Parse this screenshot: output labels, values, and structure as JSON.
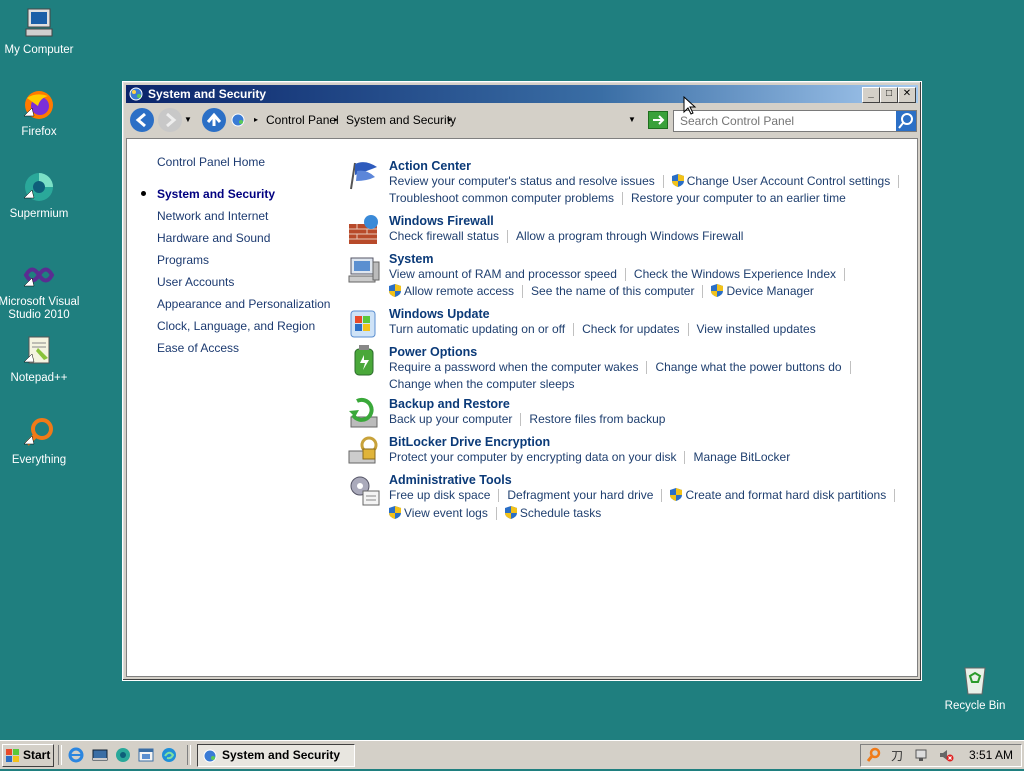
{
  "desktop": {
    "icons": [
      {
        "label": "My Computer"
      },
      {
        "label": "Firefox"
      },
      {
        "label": "Supermium"
      },
      {
        "label": "Microsoft Visual Studio 2010"
      },
      {
        "label": "Notepad++"
      },
      {
        "label": "Everything"
      },
      {
        "label": "Recycle Bin"
      }
    ]
  },
  "window": {
    "title": "System and Security",
    "breadcrumb": [
      "Control Panel",
      "System and Security"
    ],
    "search_placeholder": "Search Control Panel",
    "sidebar": {
      "items": [
        {
          "label": "Control Panel Home"
        },
        {
          "label": "System and Security",
          "active": true
        },
        {
          "label": "Network and Internet"
        },
        {
          "label": "Hardware and Sound"
        },
        {
          "label": "Programs"
        },
        {
          "label": "User Accounts"
        },
        {
          "label": "Appearance and Personalization"
        },
        {
          "label": "Clock, Language, and Region"
        },
        {
          "label": "Ease of Access"
        }
      ]
    },
    "categories": [
      {
        "title": "Action Center",
        "icon": "flag-icon",
        "links": [
          "Review your computer's status and resolve issues",
          "Change User Account Control settings",
          "Troubleshoot common computer problems",
          "Restore your computer to an earlier time"
        ]
      },
      {
        "title": "Windows Firewall",
        "icon": "firewall-icon",
        "links": [
          "Check firewall status",
          "Allow a program through Windows Firewall"
        ]
      },
      {
        "title": "System",
        "icon": "system-icon",
        "links": [
          "View amount of RAM and processor speed",
          "Check the Windows Experience Index",
          "Allow remote access",
          "See the name of this computer",
          "Device Manager"
        ]
      },
      {
        "title": "Windows Update",
        "icon": "windows-update-icon",
        "links": [
          "Turn automatic updating on or off",
          "Check for updates",
          "View installed updates"
        ]
      },
      {
        "title": "Power Options",
        "icon": "power-options-icon",
        "links": [
          "Require a password when the computer wakes",
          "Change what the power buttons do",
          "Change when the computer sleeps"
        ]
      },
      {
        "title": "Backup and Restore",
        "icon": "backup-icon",
        "links": [
          "Back up your computer",
          "Restore files from backup"
        ]
      },
      {
        "title": "BitLocker Drive Encryption",
        "icon": "bitlocker-icon",
        "links": [
          "Protect your computer by encrypting data on your disk",
          "Manage BitLocker"
        ]
      },
      {
        "title": "Administrative Tools",
        "icon": "admin-tools-icon",
        "links": [
          "Free up disk space",
          "Defragment your hard drive",
          "Create and format hard disk partitions",
          "View event logs",
          "Schedule tasks"
        ]
      }
    ]
  },
  "taskbar": {
    "start_label": "Start",
    "active_task": "System and Security",
    "clock": "3:51 AM"
  },
  "colors": {
    "desktop": "#1f7f7f",
    "title_gradient_start": "#0a246a",
    "link": "#1f3f6f",
    "category_title": "#0b3a78"
  }
}
